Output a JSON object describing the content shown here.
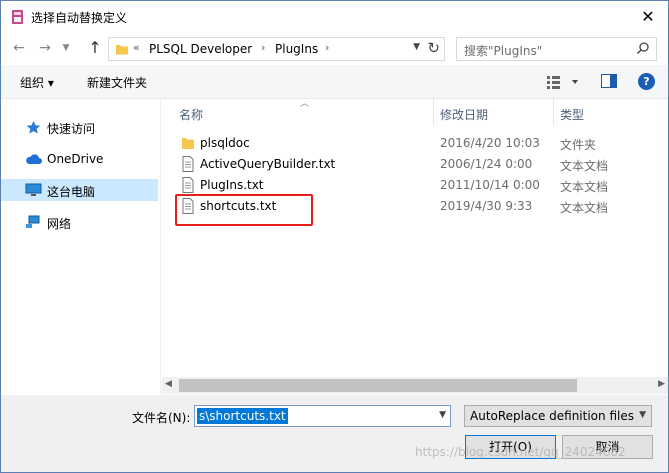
{
  "window": {
    "title": "选择自动替换定义",
    "close_glyph": "✕"
  },
  "nav": {
    "back_glyph": "←",
    "forward_glyph": "→",
    "up_glyph": "↑",
    "breadcrumb_overflow": "«",
    "path": [
      "PLSQL Developer",
      "PlugIns"
    ],
    "search_placeholder": "搜索\"PlugIns\""
  },
  "toolbar": {
    "organize_label": "组织 ▾",
    "new_folder_label": "新建文件夹",
    "help_label": "?"
  },
  "sidebar": {
    "items": [
      {
        "label": "快速访问",
        "icon": "star-icon",
        "selected": false
      },
      {
        "label": "OneDrive",
        "icon": "cloud-icon",
        "selected": false
      },
      {
        "label": "这台电脑",
        "icon": "computer-icon",
        "selected": true
      },
      {
        "label": "网络",
        "icon": "network-icon",
        "selected": false
      }
    ]
  },
  "file_list": {
    "columns": [
      "名称",
      "修改日期",
      "类型"
    ],
    "files": [
      {
        "name": "plsqldoc",
        "date": "2016/4/20 10:03",
        "type": "文件夹",
        "icon": "folder-icon"
      },
      {
        "name": "ActiveQueryBuilder.txt",
        "date": "2006/1/24 0:00",
        "type": "文本文档",
        "icon": "text-file-icon"
      },
      {
        "name": "PlugIns.txt",
        "date": "2011/10/14 0:00",
        "type": "文本文档",
        "icon": "text-file-icon"
      },
      {
        "name": "shortcuts.txt",
        "date": "2019/4/30 9:33",
        "type": "文本文档",
        "icon": "text-file-icon"
      }
    ]
  },
  "bottom": {
    "filename_label": "文件名(N):",
    "filename_value": "s\\shortcuts.txt",
    "filetype_value": "AutoReplace definition files (",
    "open_label": "打开(O)",
    "cancel_label": "取消"
  },
  "watermark": "https://blog.csdn.net/qq_24024682",
  "colors": {
    "selection": "#cce8ff",
    "accent": "#0078d7",
    "highlight_box": "#e41f1f"
  }
}
